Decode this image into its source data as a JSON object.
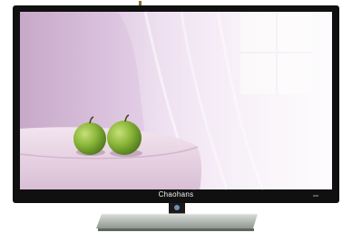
{
  "image": {
    "subject": "flat-screen-tv-product-photo",
    "background_color": "#ffffff",
    "bezel_color": "#101010"
  },
  "tv": {
    "brand_label": "Chaohans"
  }
}
